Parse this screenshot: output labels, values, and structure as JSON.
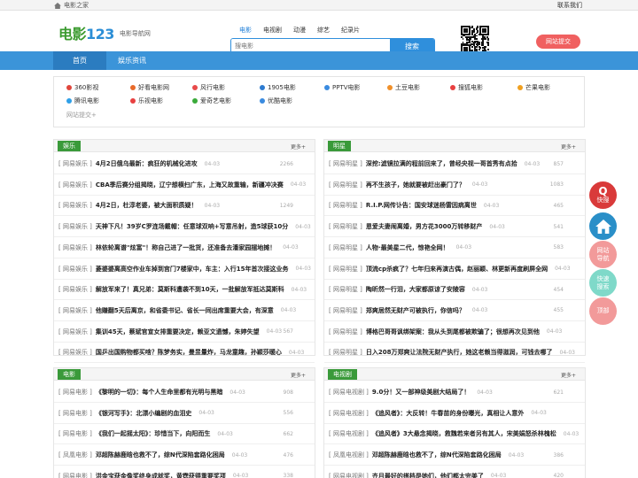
{
  "topbar": {
    "home_label": "电影之家",
    "contact_label": "联系我们"
  },
  "header": {
    "logo_main": "电影",
    "logo_num": "123",
    "logo_sub": "电影导航网",
    "categories": [
      "电影",
      "电视剧",
      "动漫",
      "综艺",
      "纪录片"
    ],
    "search_placeholder": "搜电影",
    "search_button": "搜索",
    "right_button": "网站提交",
    "colors": {
      "brand_green": "#3a9a2e",
      "accent_blue": "#2f8fdc",
      "red": "#f06060"
    }
  },
  "nav": {
    "items": [
      "首页",
      "娱乐资讯"
    ]
  },
  "sites": {
    "row1": [
      {
        "name": "360影视",
        "color": "#e0463c"
      },
      {
        "name": "好看电影网",
        "color": "#e86a2a"
      },
      {
        "name": "风行电影",
        "color": "#e84a4a"
      },
      {
        "name": "1905电影",
        "color": "#2d7bd0"
      },
      {
        "name": "PPTV电影",
        "color": "#3a8be0"
      },
      {
        "name": "土豆电影",
        "color": "#f0902a"
      },
      {
        "name": "搜狐电影",
        "color": "#e84040"
      },
      {
        "name": "芒果电影",
        "color": "#f0a020"
      }
    ],
    "row2": [
      {
        "name": "腾讯电影",
        "color": "#2fa0e8"
      },
      {
        "name": "乐视电影",
        "color": "#e84040"
      },
      {
        "name": "爱奇艺电影",
        "color": "#3aaa3a"
      },
      {
        "name": "优酷电影",
        "color": "#3a8be0"
      }
    ],
    "more": "网站提交+"
  },
  "panels": [
    {
      "title": "娱乐",
      "more": "更多+",
      "rows": [
        {
          "src": "[ 网易娱乐 ]",
          "title": "4月2日俄乌最新：疯狂的机械化进攻",
          "date": "04-03",
          "count": "2266"
        },
        {
          "src": "[ 网易娱乐 ]",
          "title": "CBA季后赛分组揭晓，辽宁想横扫广东，上海又故重输，新疆冲决赛",
          "date": "04-03",
          "count": ""
        },
        {
          "src": "[ 网易娱乐 ]",
          "title": "4月2日，杜淳老婆，被大面积质疑！",
          "date": "04-03",
          "count": "1249"
        },
        {
          "src": "[ 网易娱乐 ]",
          "title": "天神下凡！39岁C罗连场戴帽：任意球双响+写意吊射，造5球获10分",
          "date": "04-03",
          "count": ""
        },
        {
          "src": "[ 网易娱乐 ]",
          "title": "林依轮离谱\"炫富\"！称自己进了一批货，还准备去潘家园摆地摊！",
          "date": "04-03",
          "count": ""
        },
        {
          "src": "[ 网易娱乐 ]",
          "title": "菱婆婆离高空作业车掉到宫门7楼家中，车主：入行15年首次接这业务",
          "date": "04-03",
          "count": ""
        },
        {
          "src": "[ 网易娱乐 ]",
          "title": "解放军来了！真兄弟：莫斯科遭袭不到10天，一批解放军抵达莫斯科",
          "date": "04-03",
          "count": ""
        },
        {
          "src": "[ 网易娱乐 ]",
          "title": "他赚翻5天后离京，和省委书记、省长一同出席重要大会，有深意",
          "date": "04-03",
          "count": ""
        },
        {
          "src": "[ 网易娱乐 ]",
          "title": "集训45天，蔡斌官宣女排重要决定，赖亚文遗憾，朱婷失望",
          "date": "04-03",
          "count": "567"
        },
        {
          "src": "[ 网易娱乐 ]",
          "title": "国乒出国购物都买啥？陈梦务实，曼昱量炸，马龙童趣，孙颖莎暖心",
          "date": "04-03",
          "count": ""
        }
      ]
    },
    {
      "title": "明星",
      "more": "更多+",
      "rows": [
        {
          "src": "[ 网易明星 ]",
          "title": "深挖:滤镜拉满的程前回来了，曾经央视一哥首秀有点拾",
          "date": "04-03",
          "count": "857"
        },
        {
          "src": "[ 网易明星 ]",
          "title": "再不生孩子，她就要被赶出豪门了？",
          "date": "04-03",
          "count": "1083"
        },
        {
          "src": "[ 网易明星 ]",
          "title": "R.I.P.网传讣告：国安球迷杨雷因病离世",
          "date": "04-03",
          "count": "465"
        },
        {
          "src": "[ 网易明星 ]",
          "title": "恩爱夫妻闹离婚，男方花3000万转移财产",
          "date": "04-03",
          "count": "541"
        },
        {
          "src": "[ 网易明星 ]",
          "title": "人物·最美星二代，惊艳全网！",
          "date": "04-03",
          "count": "583"
        },
        {
          "src": "[ 网易明星 ]",
          "title": "顶流cp杀疯了？七年归来再演古偶，赵丽颖、林更新再度刷屏全网",
          "date": "04-03",
          "count": ""
        },
        {
          "src": "[ 网易明星 ]",
          "title": "陶昕然一行泪，大家都原谅了安陵容",
          "date": "04-03",
          "count": "454"
        },
        {
          "src": "[ 网易明星 ]",
          "title": "郑爽居然无财产可被执行，你信吗？",
          "date": "04-03",
          "count": "455"
        },
        {
          "src": "[ 网易明星 ]",
          "title": "博格巴哥哥讽绑架案：我从头到尾都被欺骗了；很想再次见到他",
          "date": "04-03",
          "count": ""
        },
        {
          "src": "[ 网易明星 ]",
          "title": "日入208万郑爽让法院无财产执行，她这老赖当得滋润，可钱去哪了",
          "date": "04-03",
          "count": ""
        }
      ]
    },
    {
      "title": "电影",
      "more": "更多+",
      "rows": [
        {
          "src": "[ 网易电影 ]",
          "title": "《黎明的一切》：每个人生命里都有光明与黑暗",
          "date": "04-03",
          "count": "908"
        },
        {
          "src": "[ 网易电影 ]",
          "title": "《银河写手》：北漂小编剧的血泪史",
          "date": "04-03",
          "count": "556"
        },
        {
          "src": "[ 网易电影 ]",
          "title": "《我们一起摇太阳》：珍惜当下，向阳而生",
          "date": "04-03",
          "count": "662"
        },
        {
          "src": "[ 凤凰电影 ]",
          "title": "邓超陈赫鹿晗也救不了，综N代深陷套路化困局",
          "date": "04-03",
          "count": "476"
        },
        {
          "src": "[ 网易电影 ]",
          "title": "洪金宝获金像奖终身成就奖，黄霑获得重要奖项",
          "date": "04-03",
          "count": "338"
        }
      ]
    },
    {
      "title": "电视剧",
      "more": "更多+",
      "rows": [
        {
          "src": "[ 网易电视剧 ]",
          "title": "9.0分！又一部神级美剧大结局了！",
          "date": "04-03",
          "count": "621"
        },
        {
          "src": "[ 网易电视剧 ]",
          "title": "《追风者》：大反转！牛春苗的身份曝光，真相让人意外",
          "date": "04-03",
          "count": ""
        },
        {
          "src": "[ 网易电视剧 ]",
          "title": "《追风者》3大悬念揭晓，救魏若来者另有其人，宋美娟怒杀林槐松",
          "date": "04-03",
          "count": ""
        },
        {
          "src": "[ 凤凰电视剧 ]",
          "title": "邓超陈赫鹿晗也救不了，综N代深陷套路化困局",
          "date": "04-03",
          "count": "386"
        },
        {
          "src": "[ 网易电视剧 ]",
          "title": "齐月最好的搭档是她们，他们都太完美了",
          "date": "04-03",
          "count": "420"
        }
      ]
    }
  ],
  "side_buttons": [
    {
      "label": "快搜",
      "color": "#d93a3a"
    },
    {
      "label": "",
      "color": "#2a8fc8"
    },
    {
      "label": "网站\n导航",
      "color": "#f29a9a"
    },
    {
      "label": "快速\n搜索",
      "color": "#7fd9c9"
    },
    {
      "label": "顶部",
      "color": "#f29a9a"
    }
  ]
}
